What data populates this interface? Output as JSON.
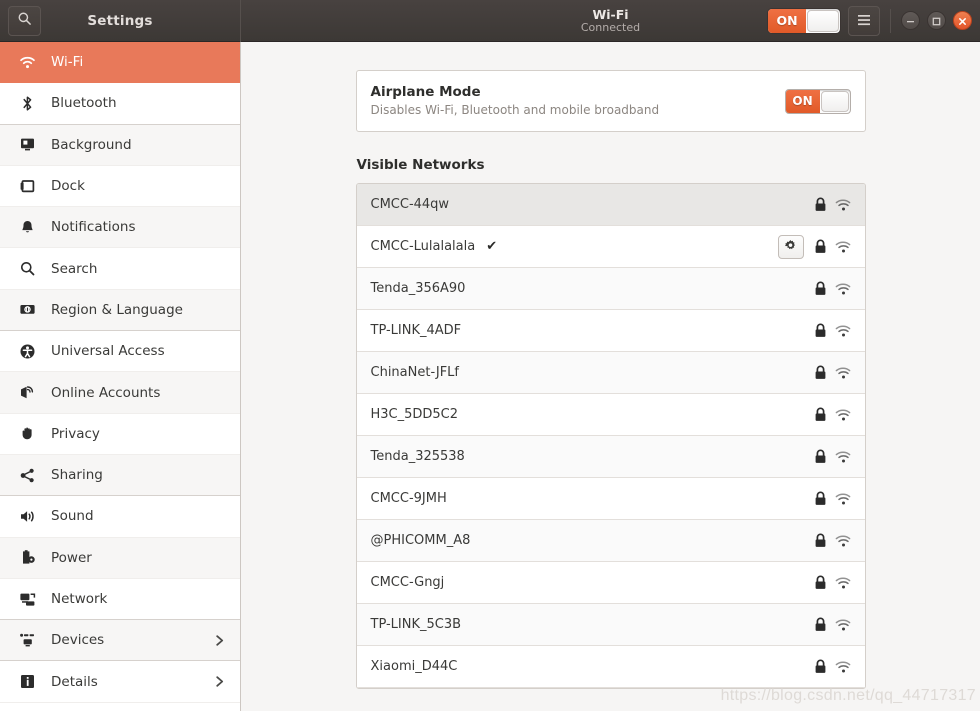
{
  "titlebar": {
    "search_icon": "search-icon",
    "app_title": "Settings",
    "page_title": "Wi-Fi",
    "page_subtitle": "Connected",
    "wifi_toggle_label": "ON",
    "menu_icon": "hamburger-menu-icon",
    "minimize_icon": "minimize-icon",
    "maximize_icon": "maximize-icon",
    "close_icon": "close-icon"
  },
  "sidebar": {
    "items": [
      {
        "label": "Wi-Fi",
        "icon": "wifi-icon",
        "selected": true,
        "chevron": false
      },
      {
        "label": "Bluetooth",
        "icon": "bluetooth-icon",
        "selected": false,
        "chevron": false
      },
      {
        "label": "Background",
        "icon": "background-icon",
        "selected": false,
        "chevron": false
      },
      {
        "label": "Dock",
        "icon": "dock-icon",
        "selected": false,
        "chevron": false
      },
      {
        "label": "Notifications",
        "icon": "bell-icon",
        "selected": false,
        "chevron": false
      },
      {
        "label": "Search",
        "icon": "search-icon",
        "selected": false,
        "chevron": false
      },
      {
        "label": "Region & Language",
        "icon": "region-language-icon",
        "selected": false,
        "chevron": false
      },
      {
        "label": "Universal Access",
        "icon": "universal-access-icon",
        "selected": false,
        "chevron": false
      },
      {
        "label": "Online Accounts",
        "icon": "online-accounts-icon",
        "selected": false,
        "chevron": false
      },
      {
        "label": "Privacy",
        "icon": "hand-icon",
        "selected": false,
        "chevron": false
      },
      {
        "label": "Sharing",
        "icon": "share-icon",
        "selected": false,
        "chevron": false
      },
      {
        "label": "Sound",
        "icon": "speaker-icon",
        "selected": false,
        "chevron": false
      },
      {
        "label": "Power",
        "icon": "power-battery-icon",
        "selected": false,
        "chevron": false
      },
      {
        "label": "Network",
        "icon": "network-icon",
        "selected": false,
        "chevron": false
      },
      {
        "label": "Devices",
        "icon": "devices-icon",
        "selected": false,
        "chevron": true
      },
      {
        "label": "Details",
        "icon": "info-icon",
        "selected": false,
        "chevron": true
      }
    ]
  },
  "content": {
    "airplane_mode": {
      "title": "Airplane Mode",
      "description": "Disables Wi-Fi, Bluetooth and mobile broadband",
      "toggle_label": "ON"
    },
    "visible_networks_title": "Visible Networks",
    "networks": [
      {
        "name": "CMCC-44qw",
        "connected": false,
        "has_settings": false,
        "secured": true
      },
      {
        "name": "CMCC-Lulalalala",
        "connected": true,
        "has_settings": true,
        "secured": true
      },
      {
        "name": "Tenda_356A90",
        "connected": false,
        "has_settings": false,
        "secured": true
      },
      {
        "name": "TP-LINK_4ADF",
        "connected": false,
        "has_settings": false,
        "secured": true
      },
      {
        "name": "ChinaNet-JFLf",
        "connected": false,
        "has_settings": false,
        "secured": true
      },
      {
        "name": "H3C_5DD5C2",
        "connected": false,
        "has_settings": false,
        "secured": true
      },
      {
        "name": "Tenda_325538",
        "connected": false,
        "has_settings": false,
        "secured": true
      },
      {
        "name": "CMCC-9JMH",
        "connected": false,
        "has_settings": false,
        "secured": true
      },
      {
        "name": "@PHICOMM_A8",
        "connected": false,
        "has_settings": false,
        "secured": true
      },
      {
        "name": "CMCC-Gngj",
        "connected": false,
        "has_settings": false,
        "secured": true
      },
      {
        "name": "TP-LINK_5C3B",
        "connected": false,
        "has_settings": false,
        "secured": true
      },
      {
        "name": "Xiaomi_D44C",
        "connected": false,
        "has_settings": false,
        "secured": true
      }
    ],
    "connected_checkmark": "✔",
    "settings_gear_icon": "gear-icon",
    "lock_icon": "lock-icon",
    "signal_icon": "wifi-signal-icon",
    "watermark": "https://blog.csdn.net/qq_44717317"
  },
  "colors": {
    "accent": "#e8795a",
    "toggle_on": "#e15a28",
    "titlebar": "#3c3835",
    "content_bg": "#f6f5f4"
  }
}
